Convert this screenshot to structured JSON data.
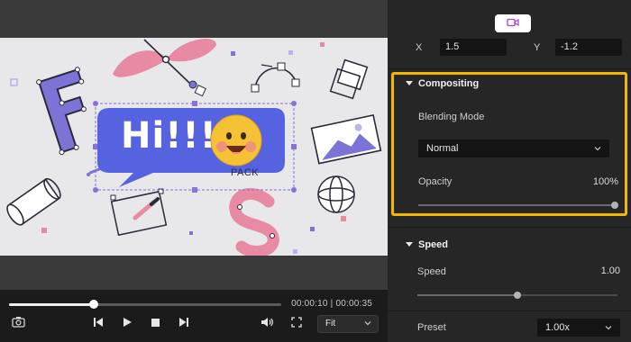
{
  "player": {
    "time_current": "00:00:10",
    "time_separator": "|",
    "time_total": "00:00:35",
    "progress": 0.31,
    "fit_label": "Fit",
    "icons": [
      "camera-icon",
      "skip-back-icon",
      "play-icon",
      "stop-icon",
      "skip-forward-icon",
      "volume-icon",
      "fullscreen-icon",
      "chevron-down-icon"
    ]
  },
  "canvas": {
    "bubble_text": "Hi!!!",
    "pack_label": "PACK",
    "bubble_color": "#5663e0",
    "accent_pink": "#e88aa3",
    "accent_purple": "#7b73d6",
    "emoji_color": "#f5c235"
  },
  "inspector": {
    "tab_icon": "video-camera-icon",
    "position": {
      "x_label": "X",
      "x_value": "1.5",
      "y_label": "Y",
      "y_value": "-1.2"
    },
    "compositing": {
      "title": "Compositing",
      "blend_label": "Blending Mode",
      "blend_value": "Normal",
      "opacity_label": "Opacity",
      "opacity_value": "100%",
      "opacity_level": 1.0,
      "highlight_color": "#f2b705"
    },
    "speed": {
      "title": "Speed",
      "speed_label": "Speed",
      "speed_value": "1.00",
      "speed_level": 0.5,
      "preset_label": "Preset",
      "preset_value": "1.00x"
    }
  }
}
